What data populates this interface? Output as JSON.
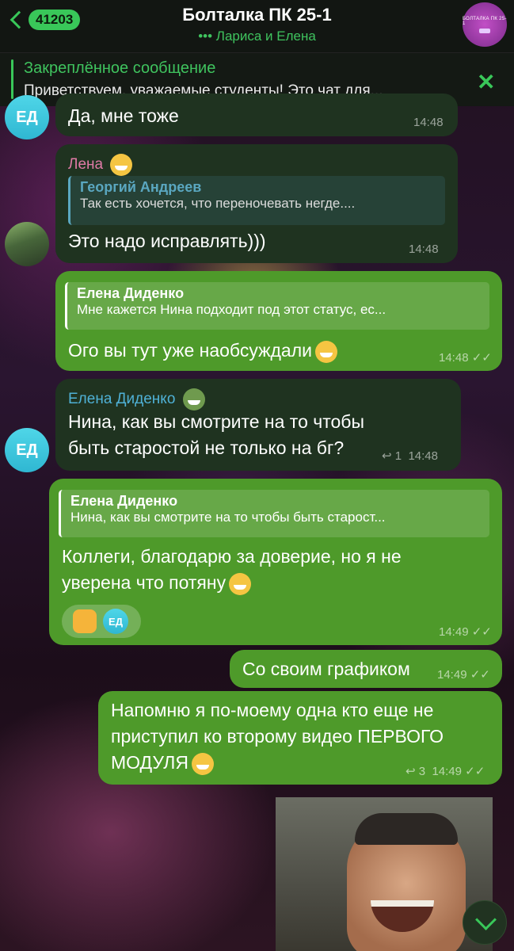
{
  "header": {
    "back_count": "41203",
    "title": "Болталка ПК 25-1",
    "typing": "••• Лариса и Елена",
    "avatar_text": "БОЛТАЛКА ПК 25-1"
  },
  "pinned": {
    "title": "Закреплённое сообщение",
    "text": "Приветствуем, уважаемые студенты! Это чат для..."
  },
  "messages": [
    {
      "avatar": "ЕД",
      "text": "Да, мне тоже",
      "time": "14:48"
    },
    {
      "author": "Лена",
      "reply_name": "Георгий Андреев",
      "reply_text": "Так есть хочется, что переночевать негде....",
      "text": "Это надо исправлять)))",
      "time": "14:48"
    },
    {
      "reply_name": "Елена Диденко",
      "reply_text": "Мне кажется Нина подходит под этот статус, ес...",
      "text": "Ого вы тут уже наобсуждали",
      "time": "14:48"
    },
    {
      "author": "Елена Диденко",
      "avatar": "ЕД",
      "text_line1": "Нина, как вы смотрите на то чтобы",
      "text_line2": "быть старостой не только на бг?",
      "replies": "1",
      "time": "14:48"
    },
    {
      "reply_name": "Елена Диденко",
      "reply_text": "Нина, как вы смотрите на то чтобы быть старост...",
      "text_line1": "Коллеги, благодарю за доверие, но я не",
      "text_line2": "уверена что потяну",
      "reaction_avatar": "ЕД",
      "time": "14:49"
    },
    {
      "text": "Со своим графиком",
      "time": "14:49"
    },
    {
      "text_line1": "Напомню я по-моему одна кто еще не",
      "text_line2": "приступил ко второму видео ПЕРВОГО",
      "text_line3": "МОДУЛЯ",
      "replies": "3",
      "time": "14:49"
    }
  ],
  "colors": {
    "accent": "#39c759",
    "incoming": "#1f3320",
    "outgoing": "#4e9a2a"
  }
}
